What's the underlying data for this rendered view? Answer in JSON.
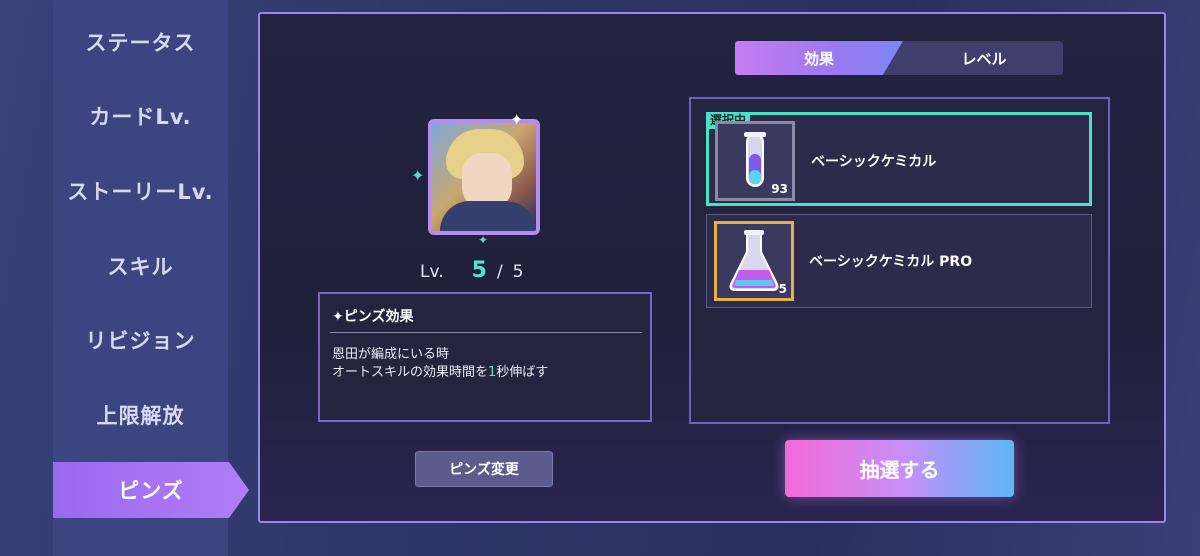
{
  "sidebar": {
    "items": [
      {
        "label": "ステータス"
      },
      {
        "label": "カードLv."
      },
      {
        "label": "ストーリーLv."
      },
      {
        "label": "スキル"
      },
      {
        "label": "リビジョン"
      },
      {
        "label": "上限解放"
      },
      {
        "label": "ピンズ"
      }
    ],
    "active": "ピンズ"
  },
  "card": {
    "level_label": "Lv.",
    "level_current": "5",
    "level_separator": "/",
    "level_max": "5"
  },
  "pins_effect": {
    "title": "✦ピンズ効果",
    "line1": "恩田が編成にいる時",
    "line2_prefix": "オートスキルの効果時間を",
    "line2_number": "1",
    "line2_suffix": "秒伸ばす"
  },
  "buttons": {
    "change_pins": "ピンズ変更",
    "draw": "抽選する"
  },
  "tabs": {
    "effect": "効果",
    "level": "レベル",
    "active": "効果"
  },
  "items": [
    {
      "name": "ベーシックケミカル",
      "count": "93",
      "badge": "選択中",
      "icon": "test-tube-icon"
    },
    {
      "name": "ベーシックケミカル PRO",
      "count": "5",
      "icon": "flask-icon"
    }
  ],
  "colors": {
    "accent_purple": "#9a68f0",
    "selected_teal": "#48e3c6",
    "gold_border": "#e3b147"
  }
}
